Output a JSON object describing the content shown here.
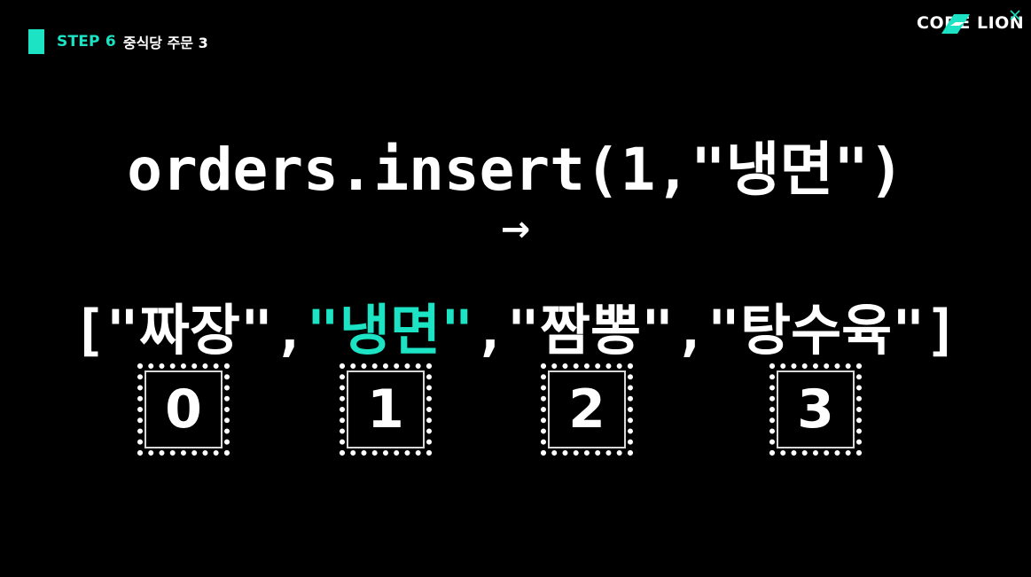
{
  "header": {
    "step_label": "STEP 6",
    "step_title": "중식당 주문 3",
    "accent_color": "#1be3c4"
  },
  "logo": {
    "text": "CODE LION",
    "icon": "close-icon"
  },
  "code": {
    "statement": "orders.insert(1,\"냉면\")",
    "arrow": "→"
  },
  "array": {
    "open_bracket": "[",
    "close_bracket": "]",
    "separator": ",",
    "items": [
      "\"짜장\"",
      "\"냉면\"",
      "\"짬뽕\"",
      "\"탕수육\""
    ],
    "highlighted_index": 1
  },
  "indices": [
    "0",
    "1",
    "2",
    "3"
  ]
}
